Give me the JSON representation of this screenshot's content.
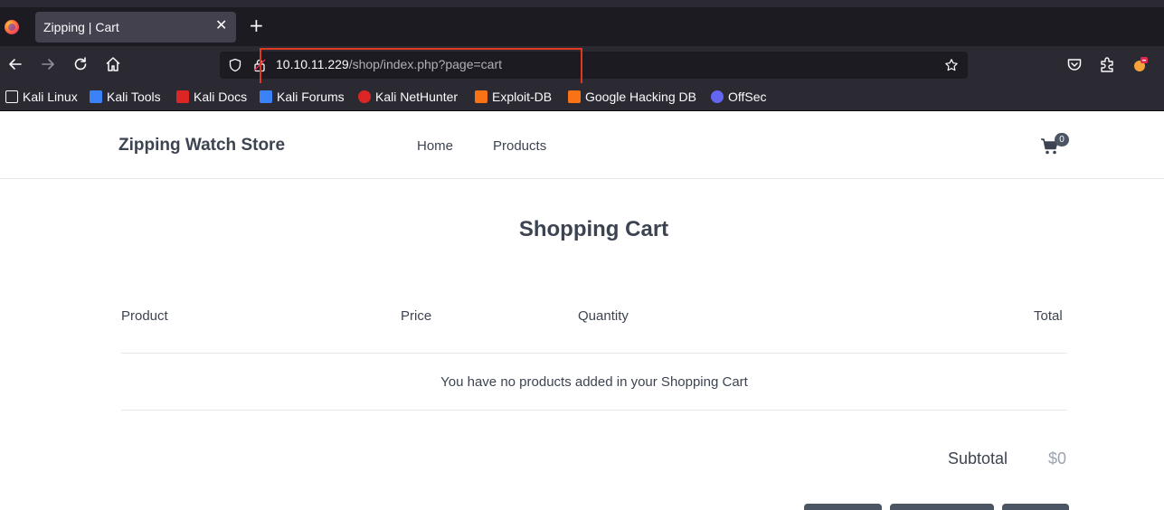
{
  "browser": {
    "tab_title": "Zipping | Cart",
    "tab_close": "✕",
    "new_tab": "+",
    "url_host": "10.10.11.229",
    "url_path": "/shop/index.php?page=cart",
    "bookmarks": [
      {
        "label": "Kali Linux",
        "icon": "kali-dragon-icon",
        "color": "#fbfbfe"
      },
      {
        "label": "Kali Tools",
        "icon": "kali-tools-icon",
        "color": "#3b82f6"
      },
      {
        "label": "Kali Docs",
        "icon": "kali-docs-icon",
        "color": "#dc2626"
      },
      {
        "label": "Kali Forums",
        "icon": "kali-forums-icon",
        "color": "#3b82f6"
      },
      {
        "label": "Kali NetHunter",
        "icon": "nethunter-icon",
        "color": "#dc2626"
      },
      {
        "label": "Exploit-DB",
        "icon": "exploit-db-icon",
        "color": "#f97316"
      },
      {
        "label": "Google Hacking DB",
        "icon": "ghdb-icon",
        "color": "#f97316"
      },
      {
        "label": "OffSec",
        "icon": "offsec-icon",
        "color": "#6366f1"
      }
    ]
  },
  "header": {
    "brand": "Zipping Watch Store",
    "menu": [
      "Home",
      "Products"
    ],
    "cart_count": "0"
  },
  "cart": {
    "title": "Shopping Cart",
    "columns": [
      "Product",
      "Price",
      "Quantity",
      "Total"
    ],
    "empty_message": "You have no products added in your Shopping Cart",
    "subtotal_label": "Subtotal",
    "subtotal_value": "$0"
  },
  "colors": {
    "chrome_dark": "#1c1b22",
    "chrome": "#2b2a33",
    "highlight_box": "#e0391f",
    "text": "#3d4451"
  }
}
